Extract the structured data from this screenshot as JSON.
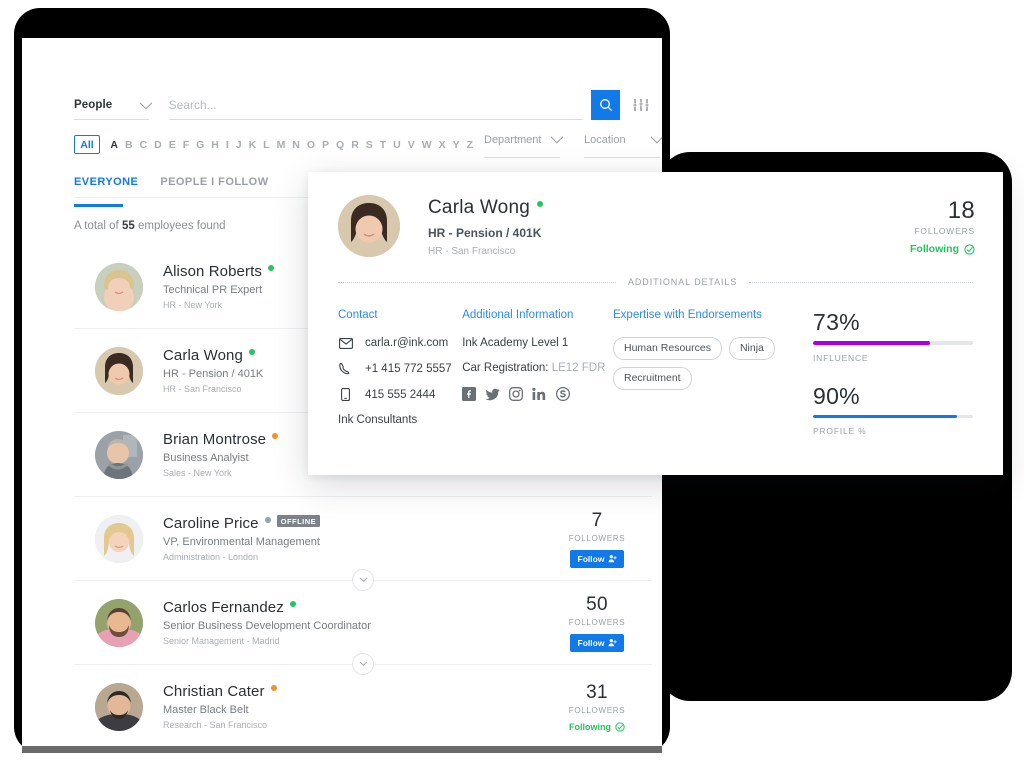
{
  "search": {
    "scope_label": "People",
    "scope_icon": "chevron-down-icon",
    "placeholder": "Search...",
    "value": "",
    "search_icon": "search-icon",
    "filter_icon": "sliders-filter-icon"
  },
  "alphabet": {
    "all_label": "All",
    "letters": [
      "A",
      "B",
      "C",
      "D",
      "E",
      "F",
      "G",
      "H",
      "I",
      "J",
      "K",
      "L",
      "M",
      "N",
      "O",
      "P",
      "Q",
      "R",
      "S",
      "T",
      "U",
      "V",
      "W",
      "X",
      "Y",
      "Z"
    ],
    "active_letter": "A"
  },
  "facets": [
    {
      "label": "Department",
      "icon": "chevron-down-icon"
    },
    {
      "label": "Location",
      "icon": "chevron-down-icon"
    }
  ],
  "tabs": [
    {
      "label": "EVERYONE",
      "active": true
    },
    {
      "label": "PEOPLE I FOLLOW",
      "active": false
    }
  ],
  "results": {
    "prefix": "A total of",
    "count": "55",
    "suffix": "employees found"
  },
  "colors": {
    "accent_blue": "#1279e8",
    "link_blue": "#2a8bf2",
    "online_green": "#22c55e",
    "away_orange": "#f0932b",
    "offline_grey": "#9aa0a6",
    "influence_purple": "#a600f0",
    "profile_blue": "#1279e8"
  },
  "people": [
    {
      "name": "Alison Roberts",
      "role": "Technical PR Expert",
      "dept": "HR - New York",
      "status": "online",
      "badge": "",
      "followers": "",
      "followers_label": "",
      "action": "none",
      "action_label": "",
      "avatar_hair": "#d9c48f",
      "avatar_skin": "#f2cfb8",
      "avatar_bg": "#c8cfbc"
    },
    {
      "name": "Carla Wong",
      "role": "HR - Pension / 401K",
      "dept": "HR - San Francisco",
      "status": "online",
      "badge": "",
      "followers": "",
      "followers_label": "",
      "action": "none",
      "action_label": "",
      "avatar_hair": "#3a2a22",
      "avatar_skin": "#f0c9ae",
      "avatar_bg": "#d8c9ae"
    },
    {
      "name": "Brian Montrose",
      "role": "Business Analyist",
      "dept": "Sales - New York",
      "status": "away",
      "badge": "",
      "followers": "",
      "followers_label": "",
      "action": "none",
      "action_label": "",
      "avatar_hair": "#b9b4ac",
      "avatar_skin": "#e8c4a8",
      "avatar_bg": "#9aa2a8"
    },
    {
      "name": "Caroline Price",
      "role": "VP, Environmental Management",
      "dept": "Administration - London",
      "status": "offline",
      "badge": "OFFLINE",
      "followers": "7",
      "followers_label": "FOLLOWERS",
      "action": "follow",
      "action_label": "Follow",
      "avatar_hair": "#e3c98f",
      "avatar_skin": "#f5d3bb",
      "avatar_bg": "#eef0f1"
    },
    {
      "name": "Carlos Fernandez",
      "role": "Senior Business Development Coordinator",
      "dept": "Senior Management - Madrid",
      "status": "online",
      "badge": "",
      "followers": "50",
      "followers_label": "FOLLOWERS",
      "action": "follow",
      "action_label": "Follow",
      "avatar_hair": "#5a4232",
      "avatar_skin": "#e8b893",
      "avatar_bg": "#94a36b"
    },
    {
      "name": "Christian Cater",
      "role": "Master Black Belt",
      "dept": "Research - San Francisco",
      "status": "away",
      "badge": "",
      "followers": "31",
      "followers_label": "FOLLOWERS",
      "action": "following",
      "action_label": "Following",
      "avatar_hair": "#2f2a26",
      "avatar_skin": "#e3b899",
      "avatar_bg": "#b9a891"
    }
  ],
  "detail": {
    "name": "Carla Wong",
    "status": "online",
    "role": "HR - Pension / 401K",
    "dept": "HR - San Francisco",
    "followers": "18",
    "followers_label": "FOLLOWERS",
    "following_label": "Following",
    "following_icon": "check-circle-icon",
    "divider_label": "ADDITIONAL DETAILS",
    "contact": {
      "title": "Contact",
      "email": "carla.r@ink.com",
      "email_icon": "envelope-icon",
      "phone": "+1 415 772 5557",
      "phone_icon": "phone-icon",
      "mobile": "415 555 2444",
      "mobile_icon": "mobile-icon",
      "company": "Ink Consultants"
    },
    "additional": {
      "title": "Additional Information",
      "academy": "Ink Academy Level 1",
      "car_registration_label": "Car Registration:",
      "car_registration_value": "LE12 FDR",
      "socials": [
        "facebook-icon",
        "twitter-icon",
        "instagram-icon",
        "linkedin-icon",
        "skype-icon"
      ]
    },
    "expertise": {
      "title": "Expertise with Endorsements",
      "tags": [
        "Human Resources",
        "Ninja",
        "Recruitment"
      ]
    },
    "meters": [
      {
        "value": "73%",
        "label": "INFLUENCE",
        "percent": 73,
        "color": "#a600f0"
      },
      {
        "value": "90%",
        "label": "PROFILE %",
        "percent": 90,
        "color": "#1279e8"
      }
    ]
  }
}
